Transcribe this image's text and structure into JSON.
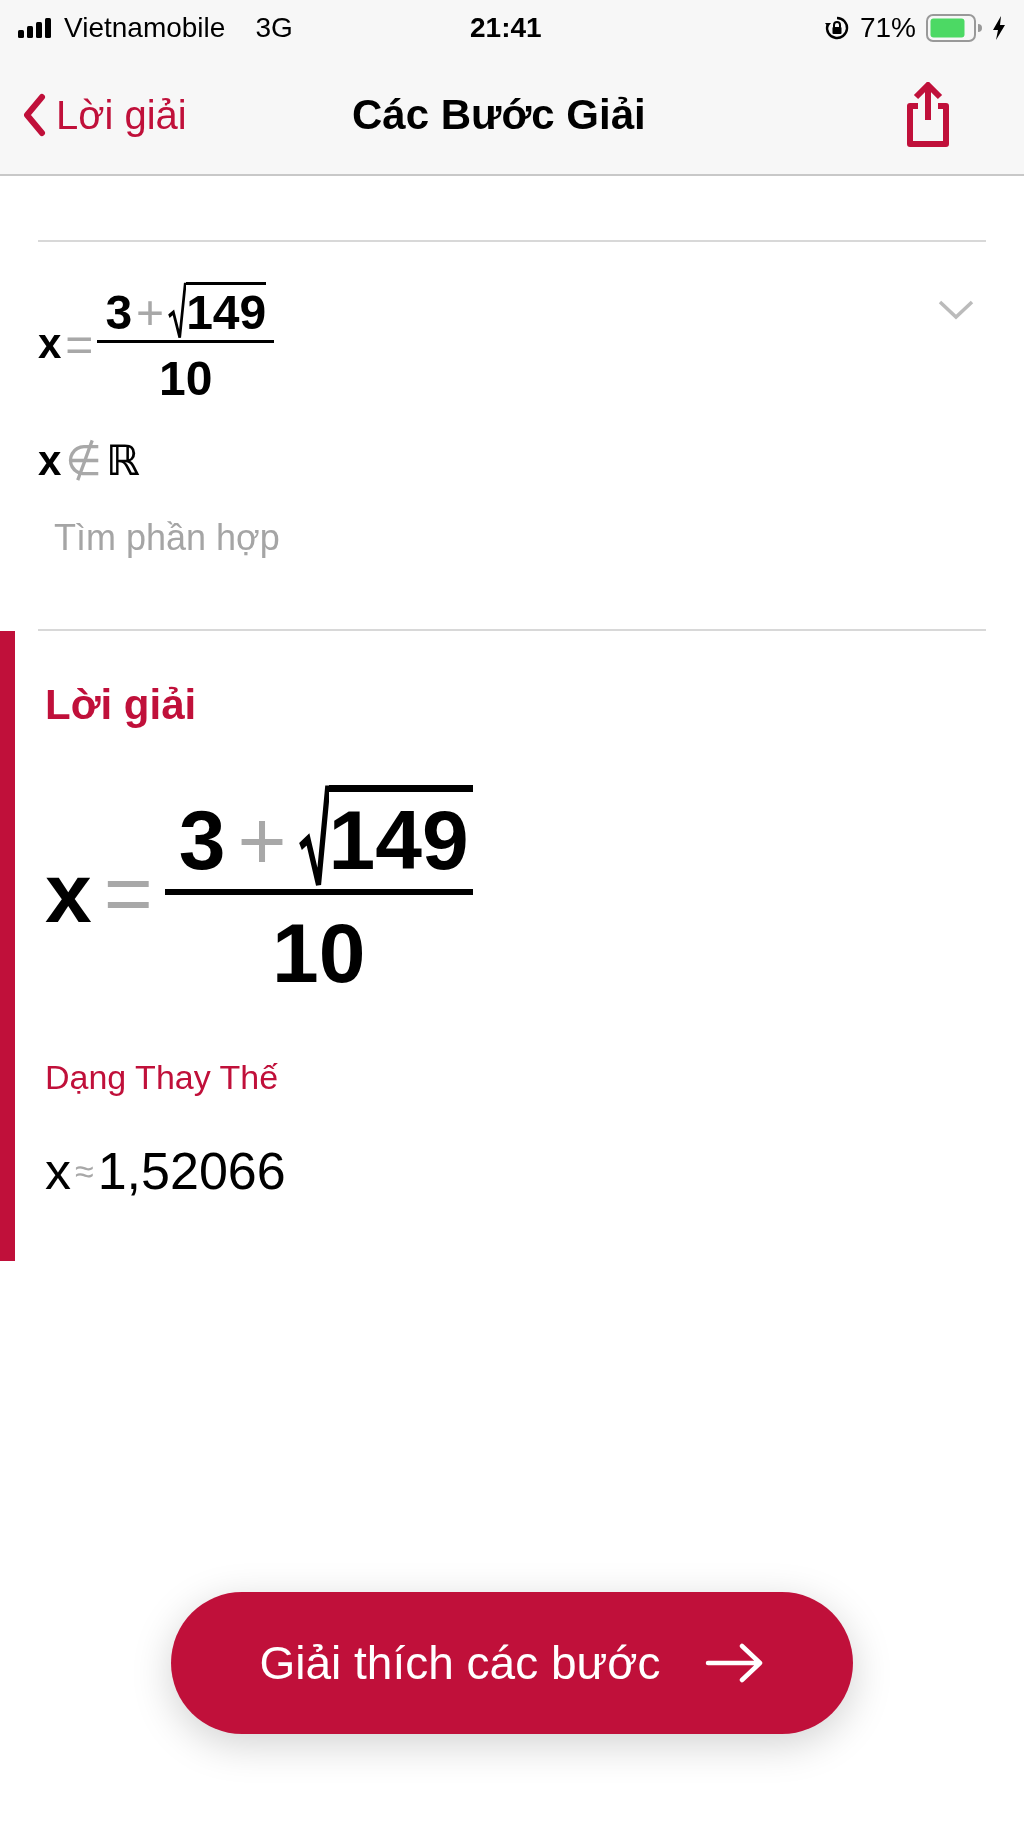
{
  "status_bar": {
    "carrier": "Vietnamobile",
    "network": "3G",
    "time": "21:41",
    "battery": "71%"
  },
  "nav": {
    "back": "Lời giải",
    "title": "Các Bước Giải"
  },
  "steps": [
    {
      "kind": "divider"
    },
    {
      "kind": "fraction",
      "lhs": "x",
      "rel": "=",
      "num": "3",
      "op": "+",
      "radicand": "149",
      "den": "10",
      "expandable": true
    },
    {
      "kind": "relation",
      "lhs": "x",
      "rel": "∉",
      "rhs": "ℝ"
    },
    {
      "kind": "text",
      "text": "Tìm phần hợp"
    },
    {
      "kind": "divider"
    }
  ],
  "solution": {
    "heading": "Lời giải",
    "result": {
      "lhs": "x",
      "rel": "=",
      "num": "3",
      "op": "+",
      "radicand": "149",
      "den": "10"
    },
    "alt_heading": "Dạng Thay Thế",
    "alt": {
      "lhs": "x",
      "rel": "≈",
      "rhs": "1,52066"
    }
  },
  "button": {
    "label": "Giải thích các bước"
  }
}
